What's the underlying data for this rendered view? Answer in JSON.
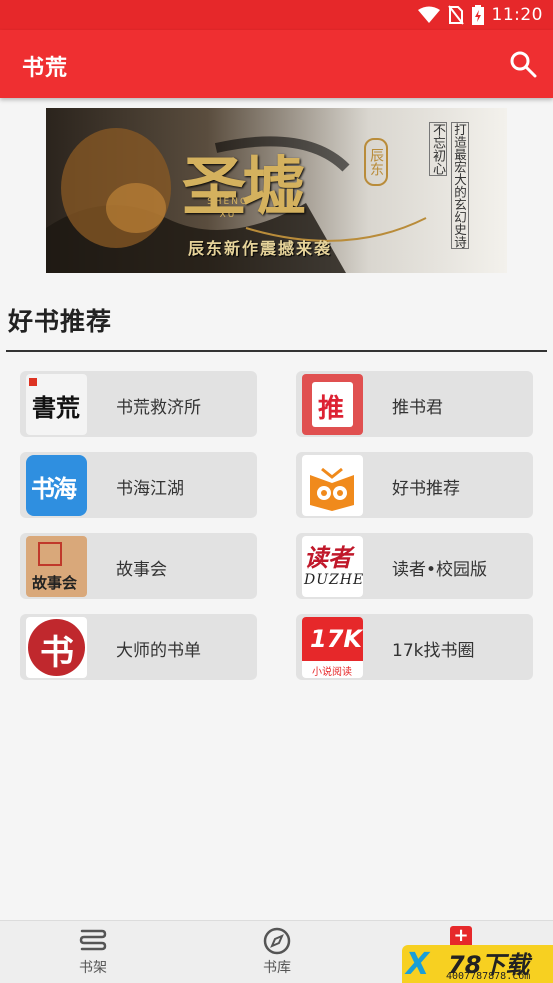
{
  "status_bar": {
    "time": "11:20",
    "icons": [
      "wifi-icon",
      "no-sim-icon",
      "battery-charging-icon"
    ]
  },
  "app_bar": {
    "title": "书荒",
    "search_icon": "search-icon"
  },
  "banner": {
    "title": "圣墟",
    "pinyin": "SHENG XU",
    "author_seal": "辰东",
    "tagline": "辰东新作震撼来袭",
    "slogan_col1": "不忘初心",
    "slogan_col2": "打造最宏大的玄幻史诗"
  },
  "section": {
    "title": "好书推荐"
  },
  "cards": [
    {
      "label": "书荒救济所",
      "logo_text": "書荒"
    },
    {
      "label": "推书君",
      "logo_text": "推"
    },
    {
      "label": "书海江湖",
      "logo_text": "书海"
    },
    {
      "label": "好书推荐",
      "logo_text": ""
    },
    {
      "label": "故事会",
      "logo_text": "故事会"
    },
    {
      "label": "读者•校园版",
      "logo_text": "读者",
      "logo_sub": "DUZHE"
    },
    {
      "label": "大师的书单",
      "logo_text": "书"
    },
    {
      "label": "17k找书圈",
      "logo_text": "17K",
      "logo_sub": "小说阅读"
    }
  ],
  "tabs": [
    {
      "label": "书架",
      "icon": "bookshelf-icon"
    },
    {
      "label": "书库",
      "icon": "compass-icon"
    }
  ],
  "watermark": {
    "big": "78下载",
    "small": "4007787878.com"
  },
  "colors": {
    "brand_red": "#ef2f31",
    "status_red": "#e6282a",
    "card_bg": "#e2e2e2"
  }
}
